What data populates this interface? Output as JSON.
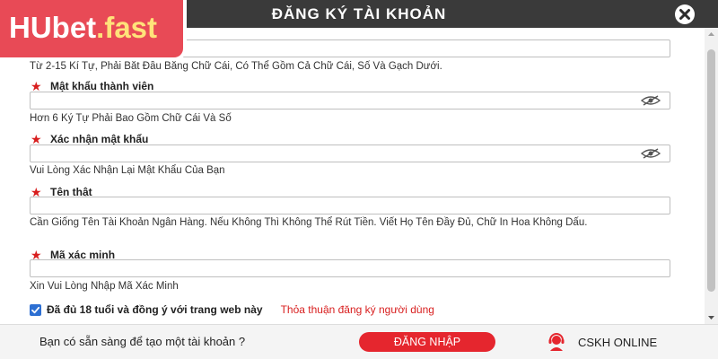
{
  "logo": {
    "part1": "HUbet",
    "part2": ".fast"
  },
  "header": {
    "title": "ĐĂNG KÝ TÀI KHOẢN"
  },
  "fields": {
    "username_hint": "Từ 2-15 Kí Tự, Phải Bắt Đầu Bằng Chữ Cái, Có Thể Gồm Cả Chữ Cái, Số Và Gạch Dưới.",
    "password_label": "Mật khẩu thành viên",
    "password_hint": "Hơn 6 Ký Tự Phải Bao Gồm Chữ Cái Và Số",
    "confirm_label": "Xác nhận mật khẩu",
    "confirm_hint": "Vui Lòng Xác Nhận Lại Mật Khẩu Của Bạn",
    "realname_label": "Tên thật",
    "realname_hint": "Cần Giống Tên Tài Khoản Ngân Hàng. Nếu Không Thì Không Thể Rút Tiền. Viết Họ Tên Đầy Đủ, Chữ In Hoa Không Dấu.",
    "captcha_label": "Mã xác minh",
    "captcha_hint": "Xin Vui Lòng Nhập Mã Xác Minh"
  },
  "agreement": {
    "checked": true,
    "text": "Đã đủ 18 tuổi và đồng ý với trang web này",
    "link": "Thỏa thuận đăng ký người dùng"
  },
  "footer": {
    "question": "Bạn có sẵn sàng để tạo một tài khoản ?",
    "login_button": "ĐĂNG NHẬP",
    "support_label": "CSKH ONLINE"
  },
  "colors": {
    "brand": "#e84a56",
    "header": "#3a3a3a",
    "accent_red": "#e5262e",
    "checkbox": "#2d6fd2"
  },
  "icons": [
    "close-icon",
    "eye-hidden-icon",
    "required-star-icon",
    "checkbox-checked-icon",
    "support-agent-icon"
  ]
}
